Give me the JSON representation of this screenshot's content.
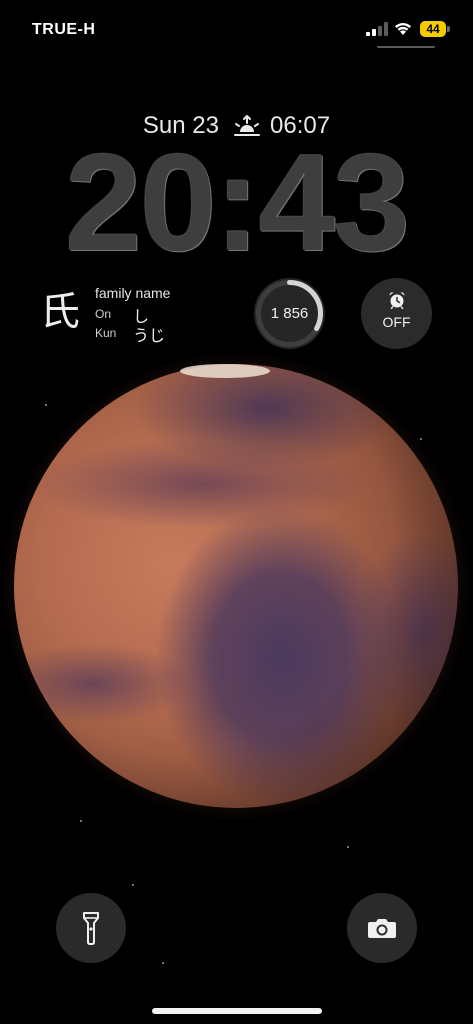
{
  "status_bar": {
    "carrier": "TRUE-H",
    "battery_level": "44",
    "battery_color": "#f5cc00",
    "icons": [
      "signal-icon",
      "wifi-icon",
      "battery-icon"
    ]
  },
  "lock_screen": {
    "date": "Sun 23",
    "sunrise_time": "06:07",
    "time": "20:43"
  },
  "widgets": {
    "kanji": {
      "character": "氏",
      "meaning": "family name",
      "on_label": "On",
      "on_reading": "し",
      "kun_label": "Kun",
      "kun_reading": "うじ"
    },
    "steps": {
      "value": "1 856",
      "progress": 0.33
    },
    "alarm": {
      "label": "OFF",
      "icon": "alarm-clock-icon"
    }
  },
  "wallpaper": {
    "subject": "mars-planet"
  },
  "controls": {
    "left": "flashlight-icon",
    "right": "camera-icon"
  }
}
